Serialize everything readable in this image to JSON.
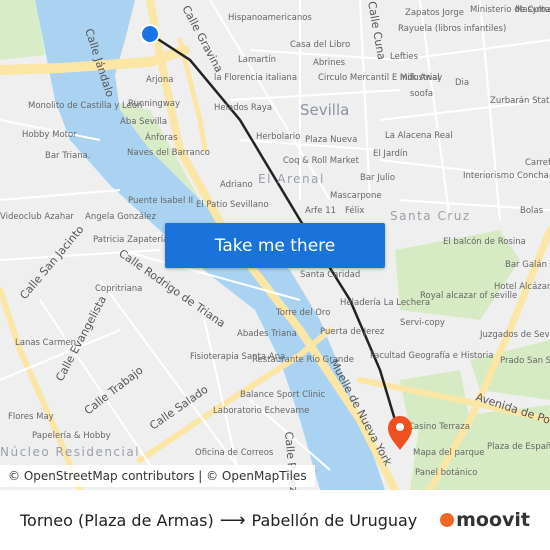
{
  "map": {
    "labels": [
      "Hispanoamericanos",
      "Zapatos Jorge",
      "Ministerio de Cultura",
      "Masymas",
      "Casa del Libro",
      "Rayuela (libros infantiles)",
      "Lamartín",
      "Abrines",
      "Lefties",
      "la Florencia italiana",
      "Circulo Mercantil E Industrial",
      "Milk Away",
      "Dia",
      "Arjona",
      "soofa",
      "Zurbarán Statue",
      "Monolito de Castilla y León",
      "Runningway",
      "Helados Raya",
      "Hobby Motor",
      "Aba Sevilla",
      "Herbolario",
      "Plaza Nueva",
      "La Alacena Real",
      "Ánforas",
      "Naves del Barranco",
      "El Jardín",
      "Bar Triana.",
      "Coq & Roll Market",
      "Carrefour",
      "Interiorismo Concha Núñez",
      "Bar Julio",
      "Adriano",
      "Mascarpone",
      "Puente Isabel II",
      "El Patio Sevillano",
      "Arfe 11",
      "Félix",
      "Bolas",
      "Videoclub Azahar",
      "Angela González",
      "Patricia Zapatería",
      "El balcón de Rosina",
      "Bar Galán",
      "Santa Caridad",
      "Copritriana",
      "Hotel Alcázar",
      "Heladería La Lechera",
      "Royal alcazar of seville",
      "Torre del Oro",
      "Abades Triana",
      "Servi-copy",
      "Puerta de Jerez",
      "Juzgados de Sevilla",
      "Lanas Carmen",
      "Fisioterapia Santa Ana",
      "Restaurante Río Grande",
      "Facultad Geografía e Historia",
      "Prado San Sebastián",
      "Balance Sport Clinic",
      "Flores May",
      "Laboratorio Echevarne",
      "Casino Terraza",
      "Papelería & Hobby",
      "Oficina de Correos",
      "Mapa del parque",
      "Plaza de España",
      "Panel botánico"
    ],
    "city_label": "Sevilla",
    "districts": [
      "El Arenal",
      "Santa Cruz",
      "Núcleo Residencial"
    ],
    "streets": [
      "Calle Jándalo",
      "Calle Gravina",
      "Calle Cuna",
      "Calle San Jacinto",
      "Calle Rodrigo de Triana",
      "Calle Evangelista",
      "Calle Trabajo",
      "Calle Salado",
      "Muelle de Nueva York",
      "Avenida de Portugal",
      "Calle Pureza"
    ],
    "origin_marker_color": "#1a73e8",
    "destination_marker_color": "#f0501e",
    "route_color": "#222222"
  },
  "cta_label": "Take me there",
  "attribution": "© OpenStreetMap contributors | © OpenMapTiles",
  "footer": {
    "origin": "Torneo (Plaza de Armas)",
    "arrow": "⟶",
    "destination": "Pabellón de Uruguay",
    "logo_text": "moovit",
    "brand_color": "#f26722"
  }
}
